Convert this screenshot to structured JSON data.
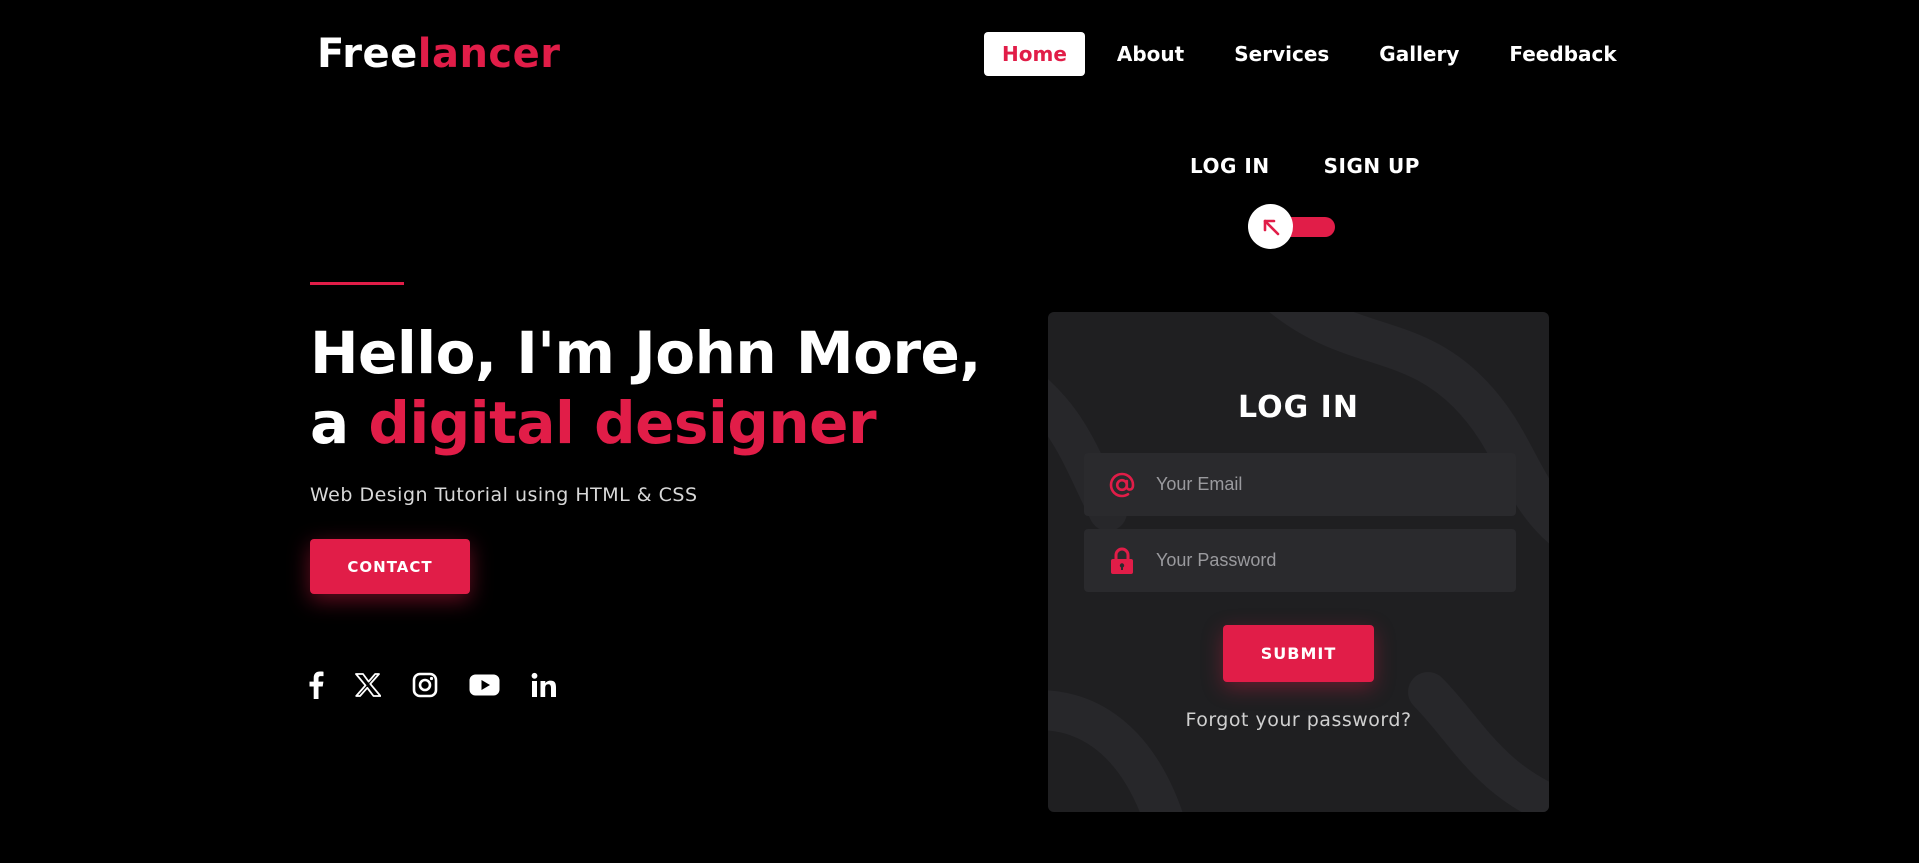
{
  "brand": {
    "logo_part1": "Free",
    "logo_part2": "lancer"
  },
  "nav": {
    "items": [
      {
        "label": "Home",
        "active": true
      },
      {
        "label": "About",
        "active": false
      },
      {
        "label": "Services",
        "active": false
      },
      {
        "label": "Gallery",
        "active": false
      },
      {
        "label": "Feedback",
        "active": false
      }
    ]
  },
  "auth_switch": {
    "login_label": "LOG IN",
    "signup_label": "SIGN UP",
    "knob_icon": "arrow-up-left-icon"
  },
  "hero": {
    "title_line1": "Hello, I'm John More,",
    "title_line2_prefix": "a ",
    "title_line2_accent": "digital designer",
    "subtitle": "Web Design Tutorial using HTML & CSS",
    "contact_label": "CONTACT"
  },
  "socials": [
    {
      "icon": "facebook-icon"
    },
    {
      "icon": "x-twitter-icon"
    },
    {
      "icon": "instagram-icon"
    },
    {
      "icon": "youtube-icon"
    },
    {
      "icon": "linkedin-icon"
    }
  ],
  "login_card": {
    "title": "LOG IN",
    "email_placeholder": "Your Email",
    "email_icon": "at-sign-icon",
    "password_placeholder": "Your Password",
    "password_icon": "lock-icon",
    "submit_label": "SUBMIT",
    "forgot_label": "Forgot your password?"
  },
  "colors": {
    "background": "#000000",
    "accent": "#e11d48",
    "card": "#1f1f21",
    "field": "#2a2a2d"
  }
}
